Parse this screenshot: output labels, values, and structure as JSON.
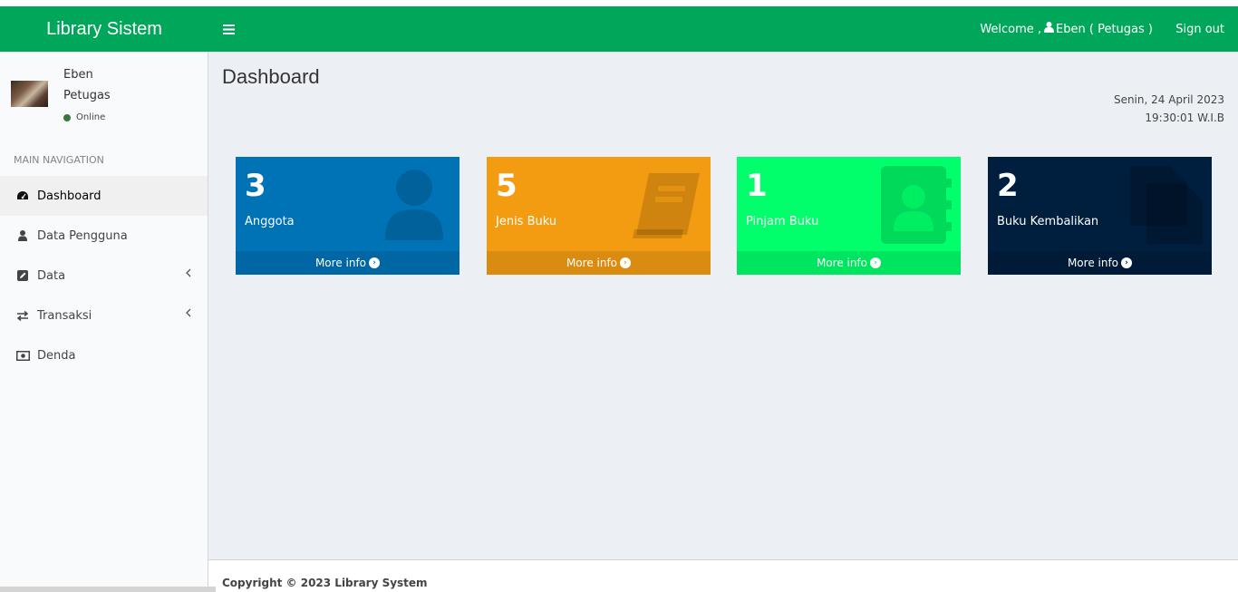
{
  "header": {
    "logo": "Library Sistem",
    "welcome_prefix": "Welcome ,",
    "welcome_user": "Eben ( Petugas )",
    "signout": "Sign out",
    "color": "#00a65a"
  },
  "sidebar": {
    "user": {
      "name": "Eben",
      "role": "Petugas",
      "status": "Online"
    },
    "nav_header": "MAIN NAVIGATION",
    "items": [
      {
        "label": "Dashboard",
        "icon": "dashboard-icon"
      },
      {
        "label": "Data Pengguna",
        "icon": "user-icon"
      },
      {
        "label": "Data",
        "icon": "edit-icon"
      },
      {
        "label": "Transaksi",
        "icon": "exchange-icon"
      },
      {
        "label": "Denda",
        "icon": "money-icon"
      }
    ]
  },
  "main": {
    "title": "Dashboard",
    "date": "Senin, 24 April 2023",
    "time": "19:30:01 W.I.B",
    "boxes": [
      {
        "value": "3",
        "label": "Anggota",
        "more": "More info",
        "color": "#0073b7",
        "icon": "user-icon"
      },
      {
        "value": "5",
        "label": "Jenis Buku",
        "more": "More info",
        "color": "#f39c12",
        "icon": "book-icon"
      },
      {
        "value": "1",
        "label": "Pinjam Buku",
        "more": "More info",
        "color": "#00ff6a",
        "icon": "address-book-icon"
      },
      {
        "value": "2",
        "label": "Buku Kembalikan",
        "more": "More info",
        "color": "#001f3f",
        "icon": "files-icon"
      }
    ]
  },
  "footer": {
    "copyright": "Copyright © 2023 Library System"
  }
}
